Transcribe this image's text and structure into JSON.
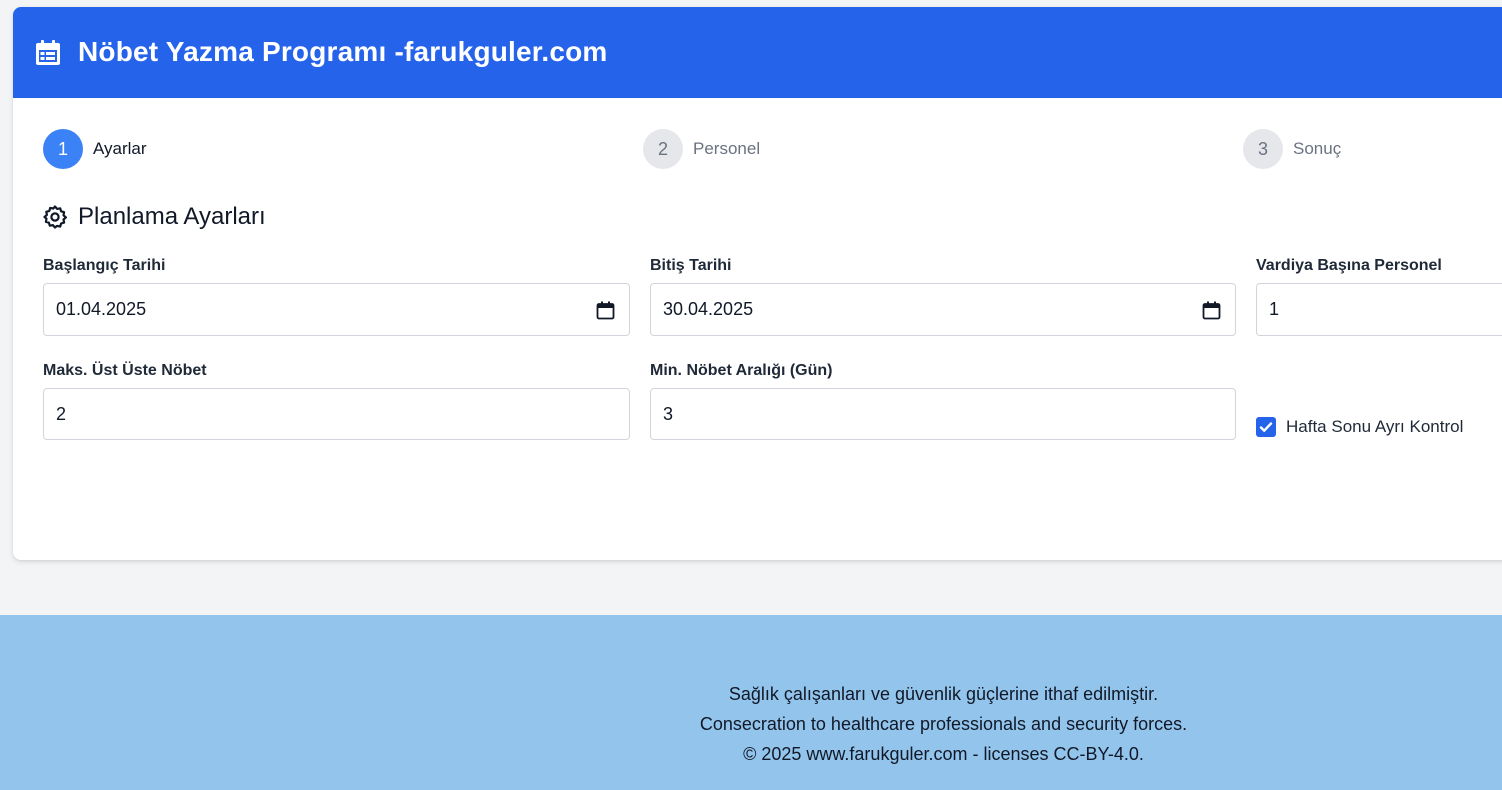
{
  "header": {
    "icon": "calendar-icon",
    "title": "Nöbet Yazma Programı -farukguler.com"
  },
  "steps": [
    {
      "number": "1",
      "label": "Ayarlar",
      "active": true
    },
    {
      "number": "2",
      "label": "Personel",
      "active": false
    },
    {
      "number": "3",
      "label": "Sonuç",
      "active": false
    }
  ],
  "section": {
    "icon": "gear-icon",
    "title": "Planlama Ayarları"
  },
  "fields": {
    "start_date": {
      "label": "Başlangıç Tarihi",
      "value": "01.04.2025",
      "icon": "calendar-icon"
    },
    "end_date": {
      "label": "Bitiş Tarihi",
      "value": "30.04.2025",
      "icon": "calendar-icon"
    },
    "staff_per_shift": {
      "label": "Vardiya Başına Personel",
      "value": "1"
    },
    "max_consecutive": {
      "label": "Maks. Üst Üste Nöbet",
      "value": "2"
    },
    "min_interval": {
      "label": "Min. Nöbet Aralığı (Gün)",
      "value": "3"
    },
    "weekend_check": {
      "label": "Hafta Sonu Ayrı Kontrol",
      "checked": true
    }
  },
  "footer": {
    "line1": "Sağlık çalışanları ve güvenlik güçlerine ithaf edilmiştir.",
    "line2": "Consecration to healthcare professionals and security forces.",
    "line3": "© 2025 www.farukguler.com - licenses CC-BY-4.0."
  },
  "colors": {
    "primary": "#2563eb",
    "step_active": "#3b82f6",
    "footer_bg": "#93c5ec",
    "page_bg": "#f3f4f6"
  }
}
